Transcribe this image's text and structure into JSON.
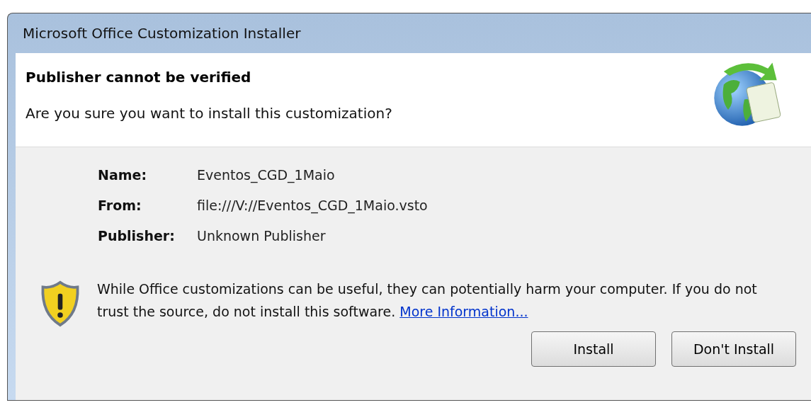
{
  "window": {
    "title": "Microsoft Office Customization Installer"
  },
  "header": {
    "heading": "Publisher cannot be verified",
    "question": "Are you sure you want to install this customization?"
  },
  "details": [
    {
      "label": "Name:",
      "value": "Eventos_CGD_1Maio"
    },
    {
      "label": "From:",
      "value": "file:///V://Eventos_CGD_1Maio.vsto"
    },
    {
      "label": "Publisher:",
      "value": "Unknown Publisher"
    }
  ],
  "warning": {
    "text": "While Office customizations can be useful, they can potentially harm your computer. If you do not trust the source, do not install this software.",
    "link": "More Information..."
  },
  "buttons": [
    "Install",
    "Don't Install"
  ]
}
